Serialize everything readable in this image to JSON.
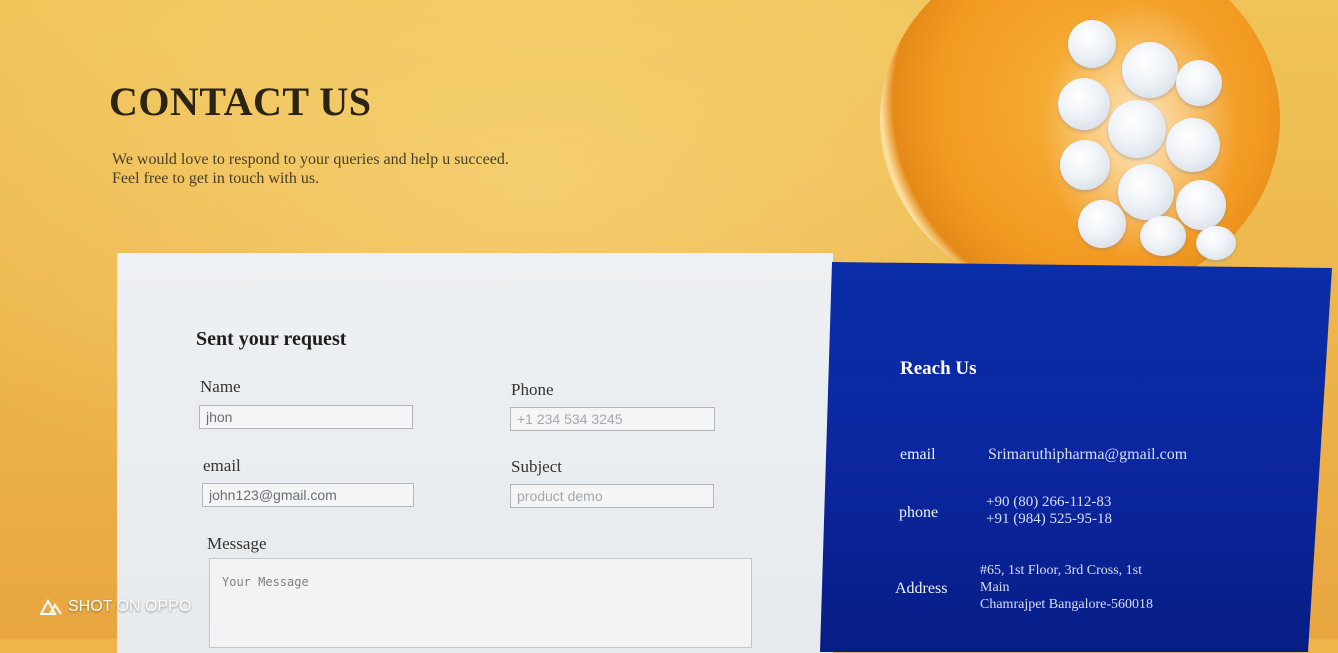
{
  "hero": {
    "title": "CONTACT US",
    "subtitle_line1": "We would love to respond to your queries and help u succeed.",
    "subtitle_line2": "Feel free to get in touch with us."
  },
  "form": {
    "title": "Sent your request",
    "name": {
      "label": "Name",
      "value": "jhon",
      "placeholder": ""
    },
    "phone": {
      "label": "Phone",
      "value": "",
      "placeholder": "+1 234 534 3245"
    },
    "email": {
      "label": "email",
      "value": "john123@gmail.com",
      "placeholder": ""
    },
    "subject": {
      "label": "Subject",
      "value": "",
      "placeholder": "product demo"
    },
    "message": {
      "label": "Message",
      "value": "",
      "placeholder": "Your Message"
    }
  },
  "reach": {
    "title": "Reach Us",
    "email_label": "email",
    "email_value": "Srimaruthipharma@gmail.com",
    "phone_label": "phone",
    "phone_line1": "+90 (80) 266-112-83",
    "phone_line2": "+91 (984) 525-95-18",
    "address_label": "Address",
    "address_line1": "#65, 1st Floor, 3rd Cross, 1st",
    "address_line2": "Main",
    "address_line3": "Chamrajpet Bangalore-560018"
  },
  "watermark": {
    "text": "SHOT ON OPPO",
    "icon": "oppo-logo-icon"
  },
  "colors": {
    "hero_bg": "#efb54a",
    "form_panel": "#eef1f3",
    "reach_panel": "#0b27a0",
    "title_text": "#2b2414"
  }
}
